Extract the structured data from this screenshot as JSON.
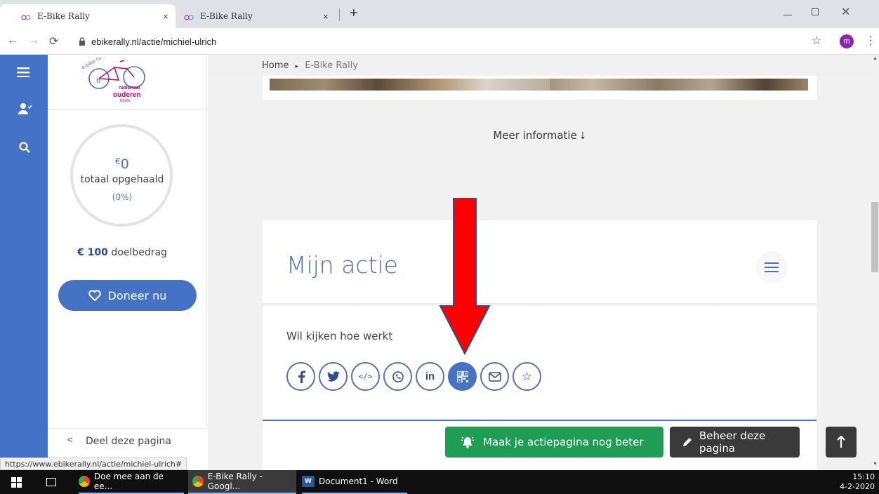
{
  "browser": {
    "tabs": [
      {
        "title": "E-Bike Rally",
        "close": "×"
      },
      {
        "title": "E-Bike Rally",
        "close": "×"
      }
    ],
    "new_tab": "+",
    "url": "ebikerally.nl/actie/michiel-ulrich",
    "profile_initial": "m",
    "status_url": "https://www.ebikerally.nl/actie/michiel-ulrich#"
  },
  "logo": {
    "line1": "e-bike rally",
    "line2": "nationaal",
    "line3": "ouderen",
    "line4": "fonds"
  },
  "sidebar": {
    "currency": "€",
    "amount": "0",
    "total_label": "totaal opgehaald",
    "percent": "(0%)",
    "progress_fraction": 0,
    "goal_amount": "€ 100",
    "goal_label": "doelbedrag",
    "donate_label": "Doneer nu",
    "share_label": "Deel deze pagina"
  },
  "breadcrumb": {
    "home": "Home",
    "sep": "▸",
    "current": "E-Bike Rally"
  },
  "main": {
    "more_info": "Meer informatie ⭣",
    "card_title": "Mijn actie",
    "card_text": "Wil kijken hoe werkt",
    "share_icons": [
      "facebook-icon",
      "twitter-icon",
      "embed-code-icon",
      "whatsapp-icon",
      "linkedin-icon",
      "qr-code-icon",
      "email-icon",
      "star-icon"
    ],
    "active_share": "qr-code-icon"
  },
  "actions": {
    "improve_label": "Maak je actiepagina nog beter",
    "manage_label": "Beheer deze pagina"
  },
  "taskbar": {
    "items": [
      "Doe mee aan de ee...",
      "E-Bike Rally - Googl...",
      "Document1 - Word"
    ],
    "time": "15:10",
    "date": "4-2-2020"
  },
  "colors": {
    "brand_blue": "#4472c4",
    "green": "#1f9d55",
    "dark": "#3a3a3a",
    "arrow": "#ff0000"
  }
}
